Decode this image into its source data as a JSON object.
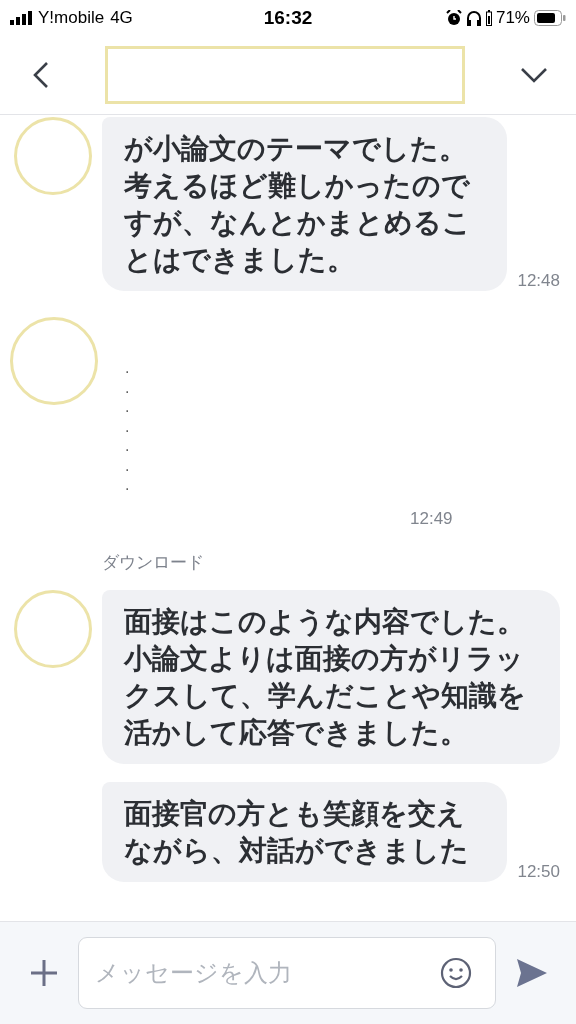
{
  "status_bar": {
    "carrier": "Y!mobile",
    "network": "4G",
    "time": "16:32",
    "battery": "71%"
  },
  "messages": [
    {
      "kind": "text",
      "avatar": true,
      "text": "が小論文のテーマでした。考えるほど難しかったのですが、なんとかまとめることはできました。",
      "time": "12:48"
    },
    {
      "kind": "dots",
      "avatar": true,
      "text": ".\n.\n.\n.\n.\n.\n.",
      "time": "12:49"
    },
    {
      "kind": "label",
      "text": "ダウンロード"
    },
    {
      "kind": "text",
      "avatar": true,
      "text": "面接はこのような内容でした。小論文よりは面接の方がリラックスして、学んだことや知識を活かして応答できました。"
    },
    {
      "kind": "text",
      "avatar": false,
      "text": "面接官の方とも笑顔を交えながら、対話ができました",
      "time": "12:50"
    }
  ],
  "composer": {
    "placeholder": "メッセージを入力"
  }
}
